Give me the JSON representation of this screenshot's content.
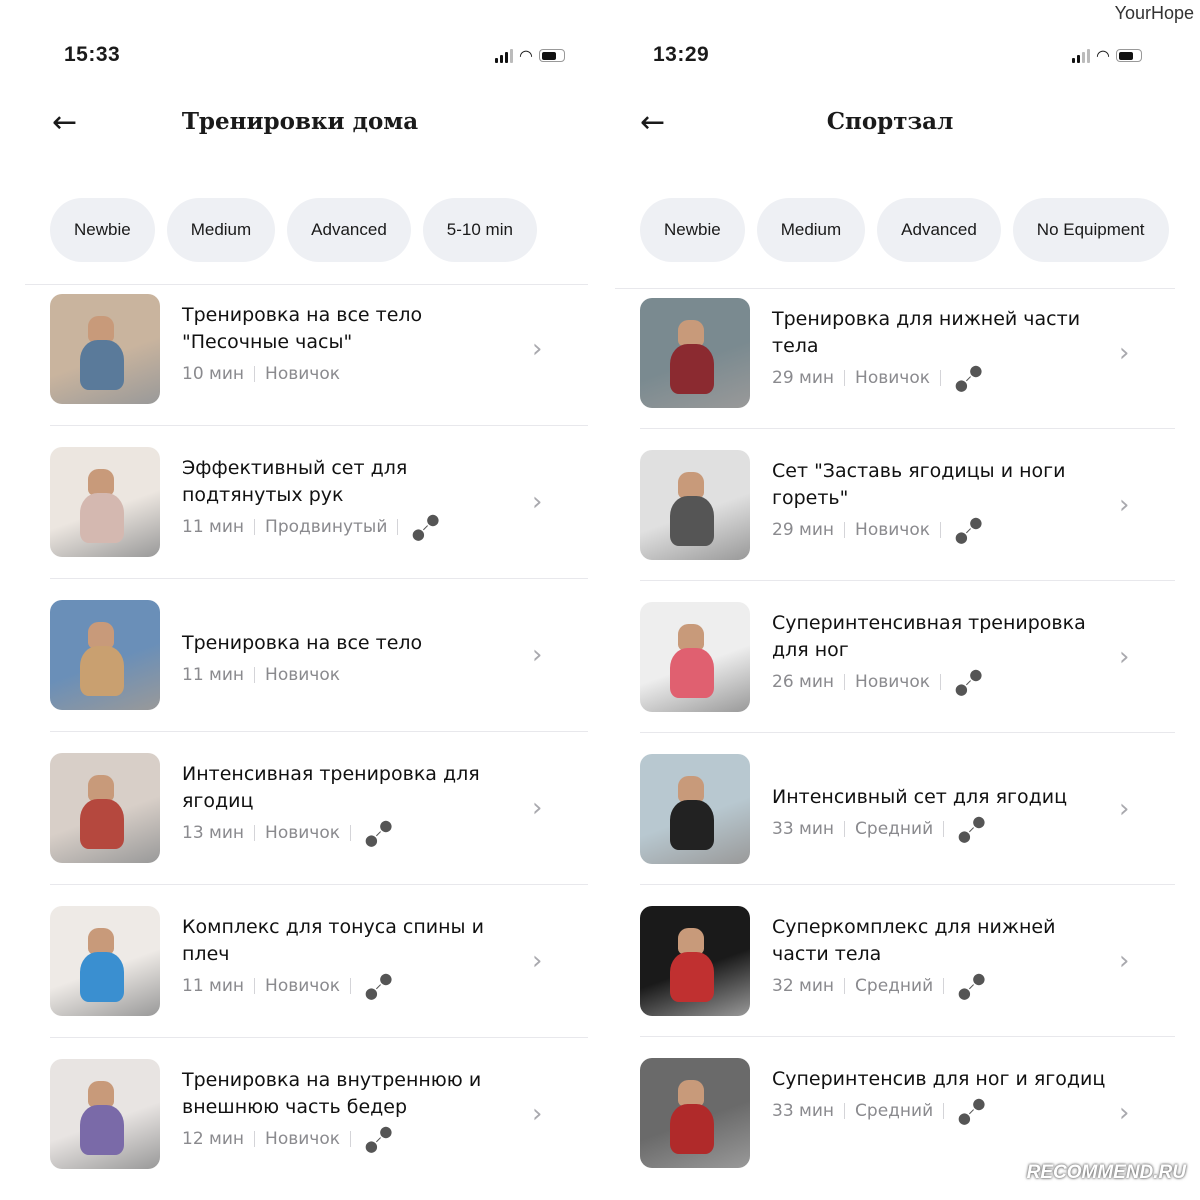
{
  "screens": [
    {
      "time": "15:33",
      "title": "Тренировки дома",
      "filters": [
        "Newbie",
        "Medium",
        "Advanced",
        "5-10 min"
      ],
      "items": [
        {
          "title": "Тренировка на все тело \"Песочные часы\"",
          "duration": "10 мин",
          "level": "Новичок",
          "equipment": false,
          "colors": [
            "#c9b49e",
            "#5a7a9a"
          ]
        },
        {
          "title": "Эффективный сет для подтянутых рук",
          "duration": "11 мин",
          "level": "Продвинутый",
          "equipment": true,
          "colors": [
            "#ece6e0",
            "#d4b8b0"
          ]
        },
        {
          "title": "Тренировка на все тело",
          "duration": "11 мин",
          "level": "Новичок",
          "equipment": false,
          "colors": [
            "#6a8fb8",
            "#c9a070"
          ]
        },
        {
          "title": "Интенсивная тренировка для ягодиц",
          "duration": "13 мин",
          "level": "Новичок",
          "equipment": true,
          "colors": [
            "#d8cfc8",
            "#b5483e"
          ]
        },
        {
          "title": "Комплекс для тонуса спины и плеч",
          "duration": "11 мин",
          "level": "Новичок",
          "equipment": true,
          "colors": [
            "#eeeae6",
            "#3a8fd0"
          ]
        },
        {
          "title": "Тренировка на внутреннюю и внешнюю часть бедер",
          "duration": "12 мин",
          "level": "Новичок",
          "equipment": true,
          "colors": [
            "#e8e4e2",
            "#7a6aa8"
          ]
        }
      ]
    },
    {
      "time": "13:29",
      "title": "Спортзал",
      "filters": [
        "Newbie",
        "Medium",
        "Advanced",
        "No Equipment"
      ],
      "items": [
        {
          "title": "Тренировка для нижней части тела",
          "duration": "29 мин",
          "level": "Новичок",
          "equipment": true,
          "colors": [
            "#7a8a90",
            "#8b2a30"
          ]
        },
        {
          "title": "Сет \"Заставь ягодицы и ноги гореть\"",
          "duration": "29 мин",
          "level": "Новичок",
          "equipment": true,
          "colors": [
            "#e0e0e0",
            "#555"
          ]
        },
        {
          "title": "Суперинтенсивная тренировка для ног",
          "duration": "26 мин",
          "level": "Новичок",
          "equipment": true,
          "colors": [
            "#eeeeee",
            "#e06070"
          ]
        },
        {
          "title": "Интенсивный сет для ягодиц",
          "duration": "33 мин",
          "level": "Средний",
          "equipment": true,
          "colors": [
            "#b8c8d0",
            "#222"
          ]
        },
        {
          "title": "Суперкомплекс для нижней части тела",
          "duration": "32 мин",
          "level": "Средний",
          "equipment": true,
          "colors": [
            "#1a1a1a",
            "#c03030"
          ]
        },
        {
          "title": "Суперинтенсив для ног и ягодиц",
          "duration": "33 мин",
          "level": "Средний",
          "equipment": true,
          "colors": [
            "#6a6a6a",
            "#b02a2a"
          ]
        }
      ]
    }
  ],
  "watermarks": {
    "top": "YourHope",
    "bottom": "RECOMMEND.RU"
  }
}
